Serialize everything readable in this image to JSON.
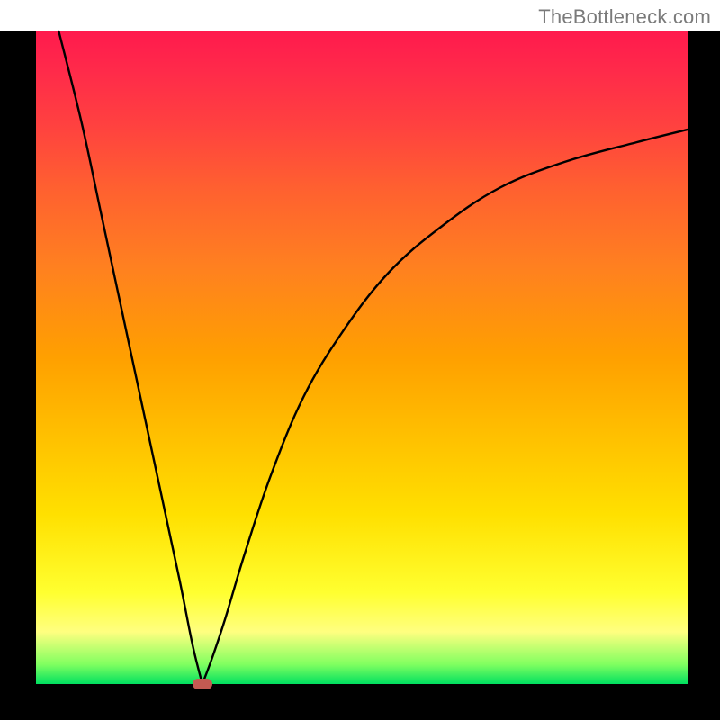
{
  "watermark": "TheBottleneck.com",
  "chart_data": {
    "type": "line",
    "title": "",
    "xlabel": "",
    "ylabel": "",
    "xlim": [
      0,
      100
    ],
    "ylim": [
      0,
      100
    ],
    "grid": false,
    "legend": false,
    "background": "rainbow-vertical-gradient (red top → green bottom)",
    "series": [
      {
        "name": "left-branch",
        "x": [
          3.5,
          7,
          10,
          13,
          16,
          19,
          22,
          24,
          25.5
        ],
        "values": [
          100,
          86,
          72,
          58,
          44,
          30,
          16,
          6,
          0
        ]
      },
      {
        "name": "right-branch",
        "x": [
          25.5,
          27,
          29,
          32,
          36,
          41,
          47,
          54,
          62,
          71,
          81,
          92,
          100
        ],
        "values": [
          0,
          4,
          10,
          20,
          32,
          44,
          54,
          63,
          70,
          76,
          80,
          83,
          85
        ]
      }
    ],
    "marker": {
      "name": "bottleneck-point",
      "x": 25.5,
      "y": 0,
      "color": "#c45a52"
    },
    "gradient_stops": [
      {
        "pos": 0,
        "color": "#ff1a4d"
      },
      {
        "pos": 0.14,
        "color": "#ff4040"
      },
      {
        "pos": 0.36,
        "color": "#ff8020"
      },
      {
        "pos": 0.5,
        "color": "#ffa000"
      },
      {
        "pos": 0.74,
        "color": "#ffe000"
      },
      {
        "pos": 0.92,
        "color": "#ffff80"
      },
      {
        "pos": 1.0,
        "color": "#00e060"
      }
    ]
  }
}
